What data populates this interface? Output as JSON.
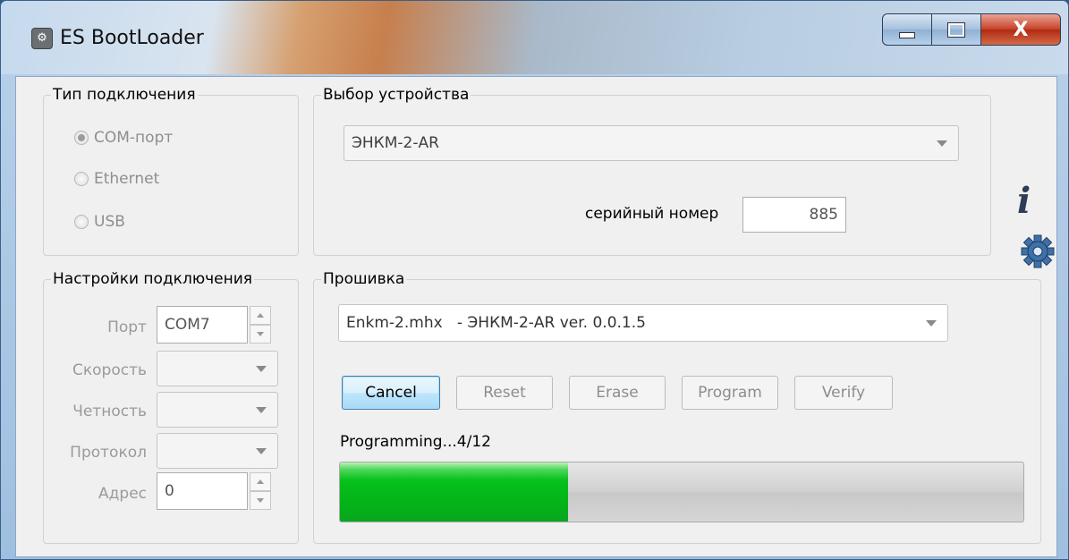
{
  "window": {
    "title": "ES BootLoader",
    "close_glyph": "X"
  },
  "connection_type": {
    "legend": "Тип подключения",
    "options": [
      "COM-порт",
      "Ethernet",
      "USB"
    ],
    "selected_index": 0
  },
  "device": {
    "legend": "Выбор устройства",
    "selected": "ЭНКМ-2-AR",
    "serial_label": "серийный номер",
    "serial_value": "885"
  },
  "connection_settings": {
    "legend": "Настройки подключения",
    "port_label": "Порт",
    "port_value": "COM7",
    "speed_label": "Скорость",
    "speed_value": "",
    "parity_label": "Четность",
    "parity_value": "",
    "protocol_label": "Протокол",
    "protocol_value": "",
    "address_label": "Адрес",
    "address_value": "0"
  },
  "firmware": {
    "legend": "Прошивка",
    "selected": "Enkm-2.mhx   - ЭНКМ-2-AR ver. 0.0.1.5",
    "buttons": {
      "cancel": "Cancel",
      "reset": "Reset",
      "erase": "Erase",
      "program": "Program",
      "verify": "Verify"
    },
    "status": "Programming...4/12",
    "progress_fraction": 0.3333
  },
  "icons": {
    "info": "info-icon",
    "settings": "gear-icon"
  },
  "colors": {
    "progress_fill": "#03b318",
    "primary_button_border": "#3c7fb1"
  }
}
